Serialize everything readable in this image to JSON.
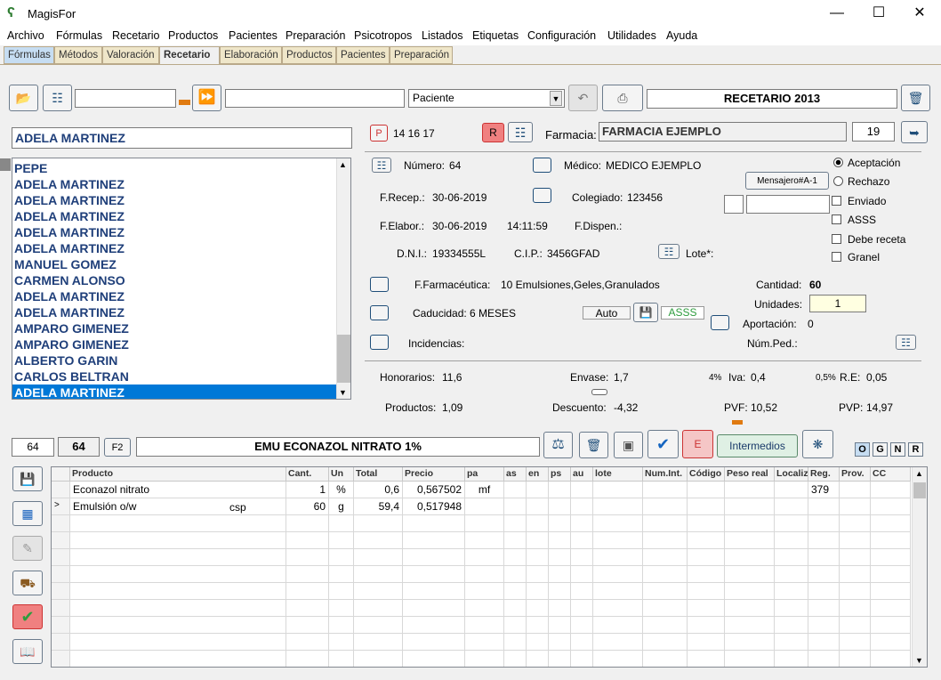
{
  "window": {
    "title": "MagisFor"
  },
  "menu": [
    "Archivo",
    "Fórmulas",
    "Recetario",
    "Productos",
    "Pacientes",
    "Preparación",
    "Psicotropos",
    "Listados",
    "Etiquetas",
    "Configuración",
    "Utilidades",
    "Ayuda"
  ],
  "tabs": [
    "Fórmulas",
    "Métodos",
    "Valoración",
    "Recetario",
    "Elaboración",
    "Productos",
    "Pacientes",
    "Preparación"
  ],
  "toolbar": {
    "search_value": "",
    "search2_value": "",
    "filter_selected": "Paciente",
    "header_title": "RECETARIO 2013"
  },
  "patient_name": "ADELA MARTINEZ",
  "patients": [
    "PEPE",
    "ADELA MARTINEZ",
    "ADELA MARTINEZ",
    "ADELA MARTINEZ",
    "ADELA MARTINEZ",
    "ADELA MARTINEZ",
    "MANUEL GOMEZ",
    "CARMEN ALONSO",
    "ADELA MARTINEZ",
    "ADELA MARTINEZ",
    "AMPARO GIMENEZ",
    "AMPARO GIMENEZ",
    "ALBERTO GARIN",
    "CARLOS BELTRAN",
    "ADELA MARTINEZ"
  ],
  "header_info": {
    "p_label": "P",
    "p_numbers": "14 16 17",
    "r_label": "R",
    "farmacia_label": "Farmacia:",
    "farmacia_value": "FARMACIA EJEMPLO",
    "farmacia_num": "19"
  },
  "details": {
    "numero_label": "Número:",
    "numero": "64",
    "medico_label": "Médico:",
    "medico": "MEDICO EJEMPLO",
    "frecep_label": "F.Recep.:",
    "frecep": "30-06-2019",
    "colegiado_label": "Colegiado:",
    "colegiado": "123456",
    "felabor_label": "F.Elabor.:",
    "felabor": "30-06-2019",
    "hora": "14:11:59",
    "fdispen_label": "F.Dispen.:",
    "dni_label": "D.N.I.:",
    "dni": "19334555L",
    "cip_label": "C.I.P.:",
    "cip": "3456GFAD",
    "lote_label": "Lote*:",
    "mensajero": "Mensajero#A-1",
    "ffarma_label": "F.Farmacéutica:",
    "ffarma": "10 Emulsiones,Geles,Granulados",
    "cantidad_label": "Cantidad:",
    "cantidad": "60",
    "unidades_label": "Unidades:",
    "unidades": "1",
    "caducidad_label": "Caducidad:",
    "caducidad": "6 MESES",
    "auto_label": "Auto",
    "asss_badge": "ASSS",
    "aportacion_label": "Aportación:",
    "aportacion": "0",
    "incidencias_label": "Incidencias:",
    "numped_label": "Núm.Ped.:"
  },
  "options": {
    "aceptacion": "Aceptación",
    "rechazo": "Rechazo",
    "enviado": "Enviado",
    "asss": "ASSS",
    "debe_receta": "Debe receta",
    "granel": "Granel"
  },
  "totals": {
    "honorarios_label": "Honorarios:",
    "honorarios": "11,6",
    "envase_label": "Envase:",
    "envase": "1,7",
    "iva_pct": "4%",
    "iva_label": "Iva:",
    "iva": "0,4",
    "re_pct": "0,5%",
    "re_label": "R.E:",
    "re": "0,05",
    "productos_label": "Productos:",
    "productos": "1,09",
    "descuento_label": "Descuento:",
    "descuento": "-4,32",
    "pvf_label": "PVF:",
    "pvf": "10,52",
    "pvp_label": "PVP:",
    "pvp": "14,97"
  },
  "formula_bar": {
    "num1": "64",
    "num2": "64",
    "f2": "F2",
    "name": "EMU ECONAZOL NITRATO 1%",
    "e_label": "E",
    "intermedios": "Intermedios",
    "letters": [
      "O",
      "G",
      "N",
      "R"
    ]
  },
  "grid": {
    "columns": [
      "Producto",
      "Cant.",
      "Un",
      "Total",
      "Precio",
      "pa",
      "as",
      "en",
      "ps",
      "au",
      "lote",
      "Num.Int.",
      "Código",
      "Peso real",
      "Localiz",
      "Reg.",
      "Prov.",
      "CC"
    ],
    "rows": [
      {
        "marker": "",
        "producto": "Econazol nitrato",
        "extra": "",
        "cant": "1",
        "un": "%",
        "total": "0,6",
        "precio": "0,567502",
        "pa": "mf",
        "reg": "379"
      },
      {
        "marker": ">",
        "producto": "Emulsión o/w",
        "extra": "csp",
        "cant": "60",
        "un": "g",
        "total": "59,4",
        "precio": "0,517948",
        "pa": "",
        "reg": ""
      }
    ]
  }
}
